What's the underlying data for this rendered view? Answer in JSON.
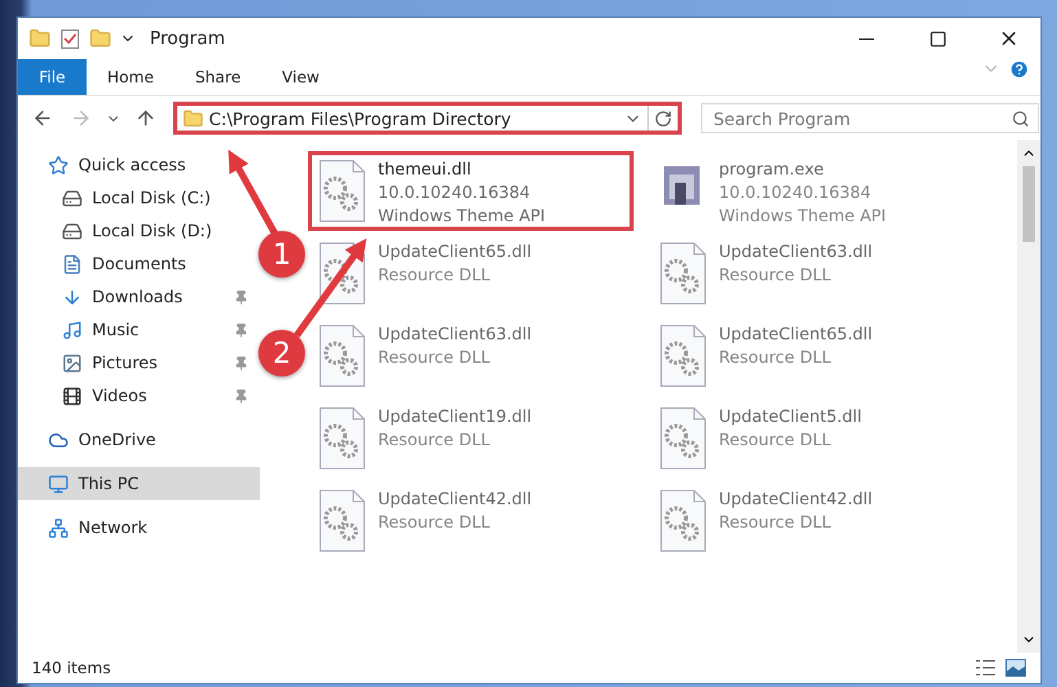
{
  "window": {
    "title": "Program"
  },
  "ribbon_tabs": [
    {
      "label": "File",
      "selected": true
    },
    {
      "label": "Home",
      "selected": false
    },
    {
      "label": "Share",
      "selected": false
    },
    {
      "label": "View",
      "selected": false
    }
  ],
  "address_bar": {
    "value": "C:\\Program Files\\Program Directory",
    "highlighted": true
  },
  "search": {
    "placeholder": "Search Program"
  },
  "sidebar": {
    "items": [
      {
        "label": "Quick access",
        "kind": "star",
        "selected": false,
        "pinned": false
      },
      {
        "label": "Local Disk (C:)",
        "kind": "disk",
        "selected": false,
        "pinned": false,
        "sub": true
      },
      {
        "label": "Local Disk (D:)",
        "kind": "disk",
        "selected": false,
        "pinned": false,
        "sub": true
      },
      {
        "label": "Documents",
        "kind": "documents",
        "selected": false,
        "pinned": false,
        "sub": true
      },
      {
        "label": "Downloads",
        "kind": "downloads",
        "selected": false,
        "pinned": true,
        "sub": true
      },
      {
        "label": "Music",
        "kind": "music",
        "selected": false,
        "pinned": true,
        "sub": true
      },
      {
        "label": "Pictures",
        "kind": "pictures",
        "selected": false,
        "pinned": true,
        "sub": true
      },
      {
        "label": "Videos",
        "kind": "videos",
        "selected": false,
        "pinned": true,
        "sub": true
      },
      {
        "label": "OneDrive",
        "kind": "cloud",
        "selected": false,
        "pinned": false,
        "gap": true
      },
      {
        "label": "This PC",
        "kind": "pc",
        "selected": true,
        "pinned": false,
        "gap": true
      },
      {
        "label": "Network",
        "kind": "network",
        "selected": false,
        "pinned": false,
        "gap": true
      }
    ]
  },
  "files": [
    {
      "name": "themeui.dll",
      "kind": "dll",
      "dimmed": false,
      "highlighted": true,
      "lines": [
        "10.0.10240.16384",
        "Windows Theme API"
      ]
    },
    {
      "name": "program.exe",
      "kind": "exe",
      "dimmed": true,
      "highlighted": false,
      "lines": [
        "10.0.10240.16384",
        "Windows Theme API"
      ]
    },
    {
      "name": "UpdateClient65.dll",
      "kind": "dll",
      "dimmed": true,
      "highlighted": false,
      "lines": [
        "Resource DLL"
      ]
    },
    {
      "name": "UpdateClient63.dll",
      "kind": "dll",
      "dimmed": true,
      "highlighted": false,
      "lines": [
        "Resource DLL"
      ]
    },
    {
      "name": "UpdateClient63.dll",
      "kind": "dll",
      "dimmed": true,
      "highlighted": false,
      "lines": [
        "Resource DLL"
      ]
    },
    {
      "name": "UpdateClient65.dll",
      "kind": "dll",
      "dimmed": true,
      "highlighted": false,
      "lines": [
        "Resource DLL"
      ]
    },
    {
      "name": "UpdateClient19.dll",
      "kind": "dll",
      "dimmed": true,
      "highlighted": false,
      "lines": [
        "Resource DLL"
      ]
    },
    {
      "name": "UpdateClient5.dll",
      "kind": "dll",
      "dimmed": true,
      "highlighted": false,
      "lines": [
        "Resource DLL"
      ]
    },
    {
      "name": "UpdateClient42.dll",
      "kind": "dll",
      "dimmed": true,
      "highlighted": false,
      "lines": [
        "Resource DLL"
      ]
    },
    {
      "name": "UpdateClient42.dll",
      "kind": "dll",
      "dimmed": true,
      "highlighted": false,
      "lines": [
        "Resource DLL"
      ]
    }
  ],
  "status_bar": {
    "count": "140 items"
  },
  "annotations": [
    {
      "label": "1"
    },
    {
      "label": "2"
    }
  ]
}
